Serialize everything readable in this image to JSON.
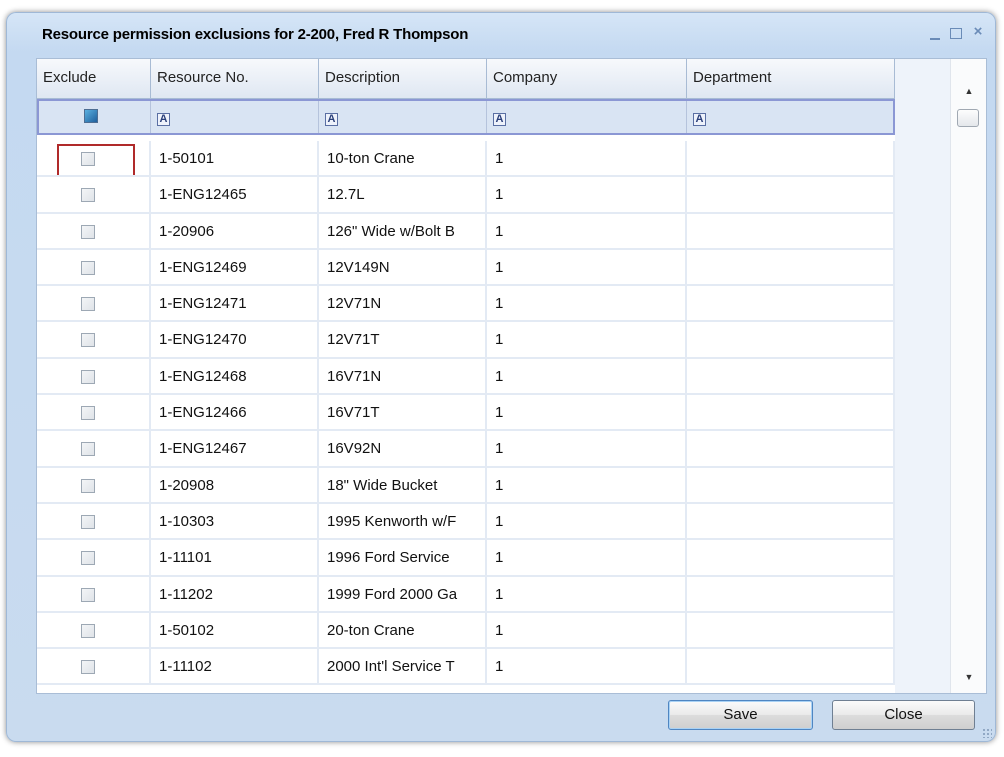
{
  "window": {
    "title": "Resource permission exclusions for 2-200, Fred R Thompson",
    "controls": {
      "minimize": "_",
      "maximize": "□",
      "close": "×"
    }
  },
  "grid": {
    "columns": [
      "Exclude",
      "Resource No.",
      "Description",
      "Company",
      "Department"
    ],
    "filter_icon": "A",
    "rows": [
      {
        "resource_no": "1-50101",
        "description": "10-ton Crane",
        "company": "1",
        "department": ""
      },
      {
        "resource_no": "1-ENG12465",
        "description": "12.7L",
        "company": "1",
        "department": ""
      },
      {
        "resource_no": "1-20906",
        "description": "126\" Wide w/Bolt B",
        "company": "1",
        "department": ""
      },
      {
        "resource_no": "1-ENG12469",
        "description": "12V149N",
        "company": "1",
        "department": ""
      },
      {
        "resource_no": "1-ENG12471",
        "description": "12V71N",
        "company": "1",
        "department": ""
      },
      {
        "resource_no": "1-ENG12470",
        "description": "12V71T",
        "company": "1",
        "department": ""
      },
      {
        "resource_no": "1-ENG12468",
        "description": "16V71N",
        "company": "1",
        "department": ""
      },
      {
        "resource_no": "1-ENG12466",
        "description": "16V71T",
        "company": "1",
        "department": ""
      },
      {
        "resource_no": "1-ENG12467",
        "description": "16V92N",
        "company": "1",
        "department": ""
      },
      {
        "resource_no": "1-20908",
        "description": "18\" Wide Bucket",
        "company": "1",
        "department": ""
      },
      {
        "resource_no": "1-10303",
        "description": "1995 Kenworth w/F",
        "company": "1",
        "department": ""
      },
      {
        "resource_no": "1-11101",
        "description": "1996 Ford Service",
        "company": "1",
        "department": ""
      },
      {
        "resource_no": "1-11202",
        "description": "1999 Ford 2000 Ga",
        "company": "1",
        "department": ""
      },
      {
        "resource_no": "1-50102",
        "description": "20-ton Crane",
        "company": "1",
        "department": ""
      },
      {
        "resource_no": "1-11102",
        "description": "2000 Int'l Service T",
        "company": "1",
        "department": ""
      }
    ]
  },
  "buttons": {
    "save": "Save",
    "close": "Close"
  },
  "colors": {
    "highlight": "#b02a2a",
    "accent": "#4f86c2"
  }
}
